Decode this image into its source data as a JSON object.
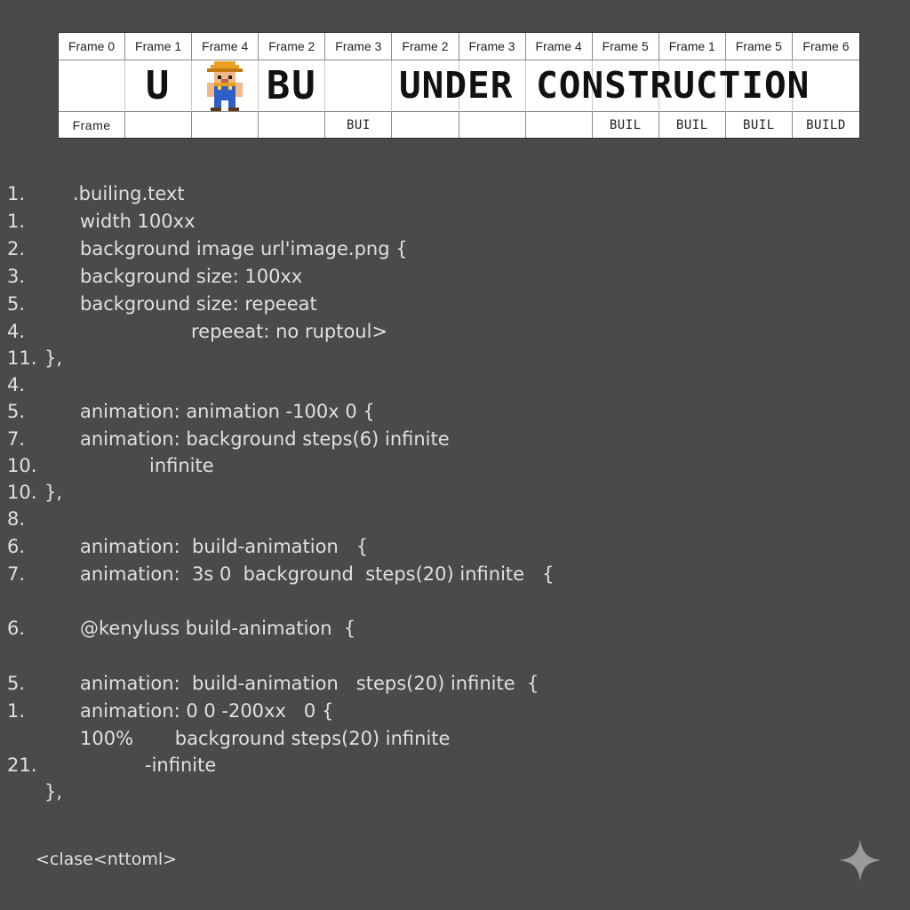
{
  "sprite_sheet": {
    "headers": [
      "Frame 0",
      "Frame 1",
      "Frame 4",
      "Frame 2",
      "Frame 3",
      "Frame 2",
      "Frame 3",
      "Frame 4",
      "Frame 5",
      "Frame 1",
      "Frame 5",
      "Frame 6"
    ],
    "middle": [
      "",
      "U",
      "",
      "BU",
      "",
      "",
      "",
      "",
      "",
      "",
      "",
      ""
    ],
    "banner_text": "UNDER CONSTRUCTION",
    "footers": [
      "Frame",
      "",
      "",
      "",
      "BUI",
      "",
      "",
      "",
      "BUIL",
      "BUIL",
      "BUIL",
      "BUILD"
    ],
    "worker_icon": "construction-worker-icon"
  },
  "code_lines": [
    {
      "num": "1.",
      "text": ".builing.text"
    },
    {
      "num": "1.",
      "text": "width 100xx"
    },
    {
      "num": "2.",
      "text": "background image url'image.png {"
    },
    {
      "num": "3.",
      "text": "background size: 100xx"
    },
    {
      "num": "5.",
      "text": "background size: repeeat"
    },
    {
      "num": "4.",
      "text": "repeeat: no ruptoul>"
    },
    {
      "num": "11.",
      "text": "},"
    },
    {
      "num": "4.",
      "text": ""
    },
    {
      "num": "5.",
      "text": "animation: animation -100x 0 {"
    },
    {
      "num": "7.",
      "text": "animation: background steps(6) infinite"
    },
    {
      "num": "10.",
      "text": "infinite"
    },
    {
      "num": "10.",
      "text": "},"
    },
    {
      "num": "8.",
      "text": ""
    },
    {
      "num": "6.",
      "text": "animation:  build-animation   {"
    },
    {
      "num": "7.",
      "text": "animation:  3s 0  background  steps(20) infinite   {"
    },
    {
      "num": "6.",
      "text": "@kenyluss build-animation  {"
    },
    {
      "num": "5.",
      "text": "animation:  build-animation   steps(20) infinite  {"
    },
    {
      "num": "1.",
      "text": "animation: 0 0 -200xx   0 {"
    },
    {
      "num": "",
      "text": "100%       background steps(20) infinite"
    },
    {
      "num": "21.",
      "text": "-infinite"
    },
    {
      "num": "",
      "text": "},"
    }
  ],
  "footer_tag": "<clase<nttoml>",
  "sparkle_icon": "sparkle-icon",
  "colors": {
    "background": "#4a4a4a",
    "code_text": "#e0e0e0",
    "sheet_bg": "#ffffff"
  }
}
